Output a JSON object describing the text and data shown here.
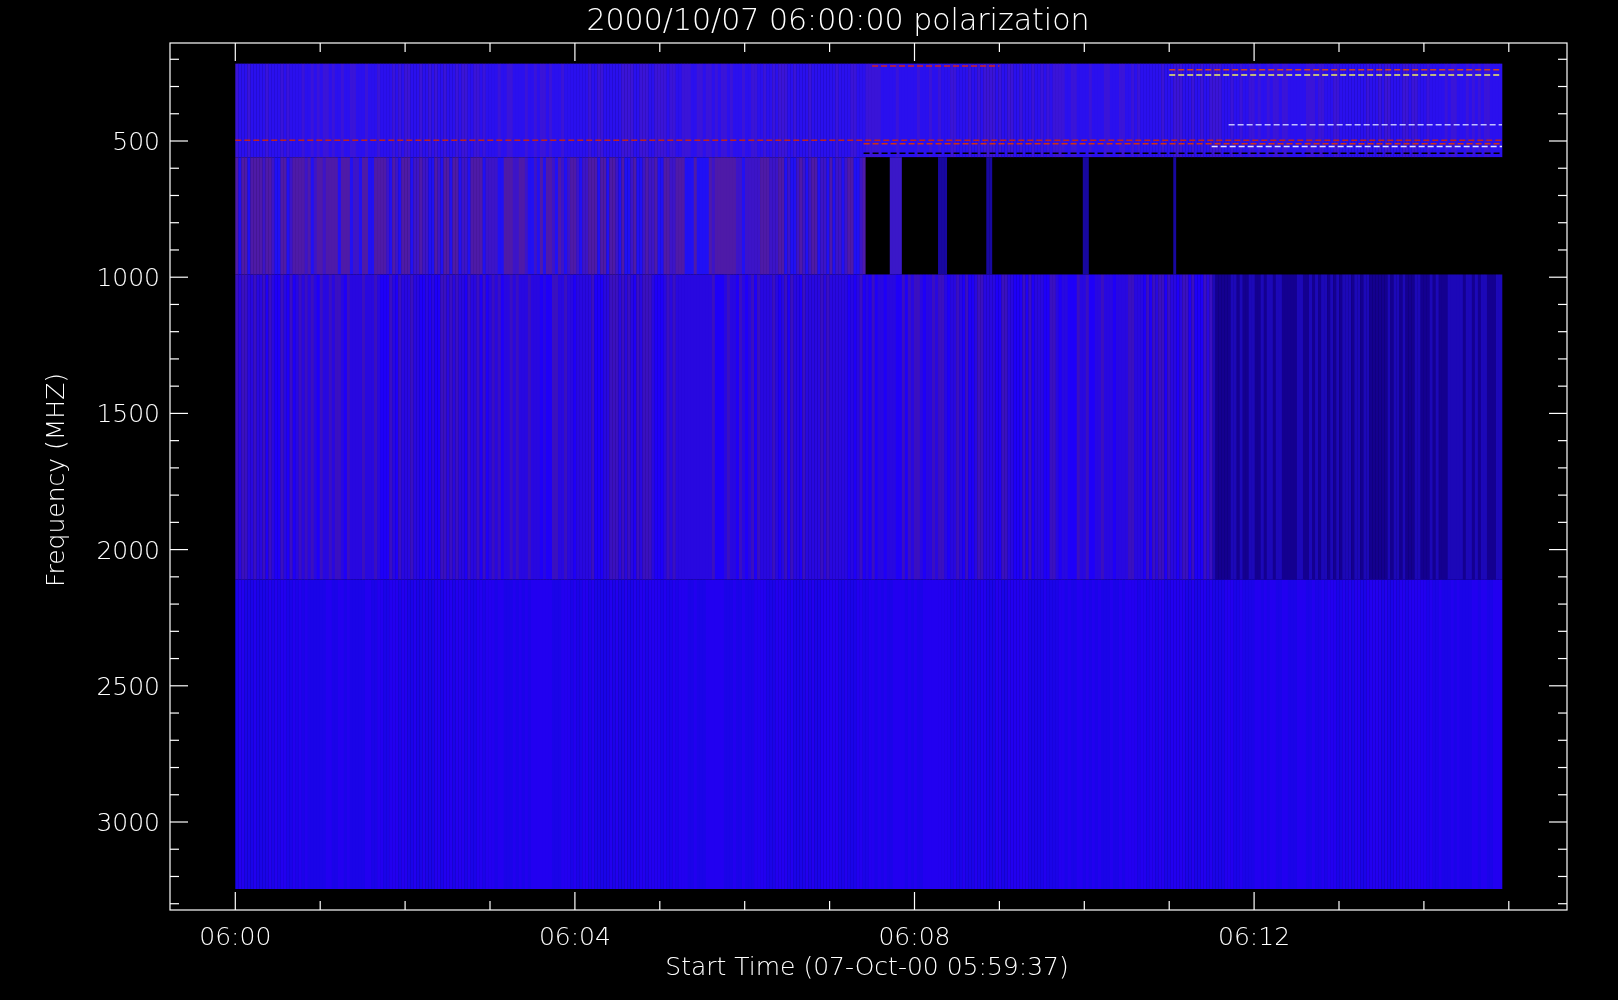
{
  "title": "2000/10/07 06:00:00 polarization",
  "y_axis": {
    "label": "Frequency (MHZ)",
    "tick_labels": [
      "500",
      "1000",
      "1500",
      "2000",
      "2500",
      "3000"
    ]
  },
  "x_axis": {
    "label": "Start Time (07-Oct-00 05:59:37)",
    "tick_labels": [
      "06:00",
      "06:04",
      "06:08",
      "06:12"
    ]
  }
}
